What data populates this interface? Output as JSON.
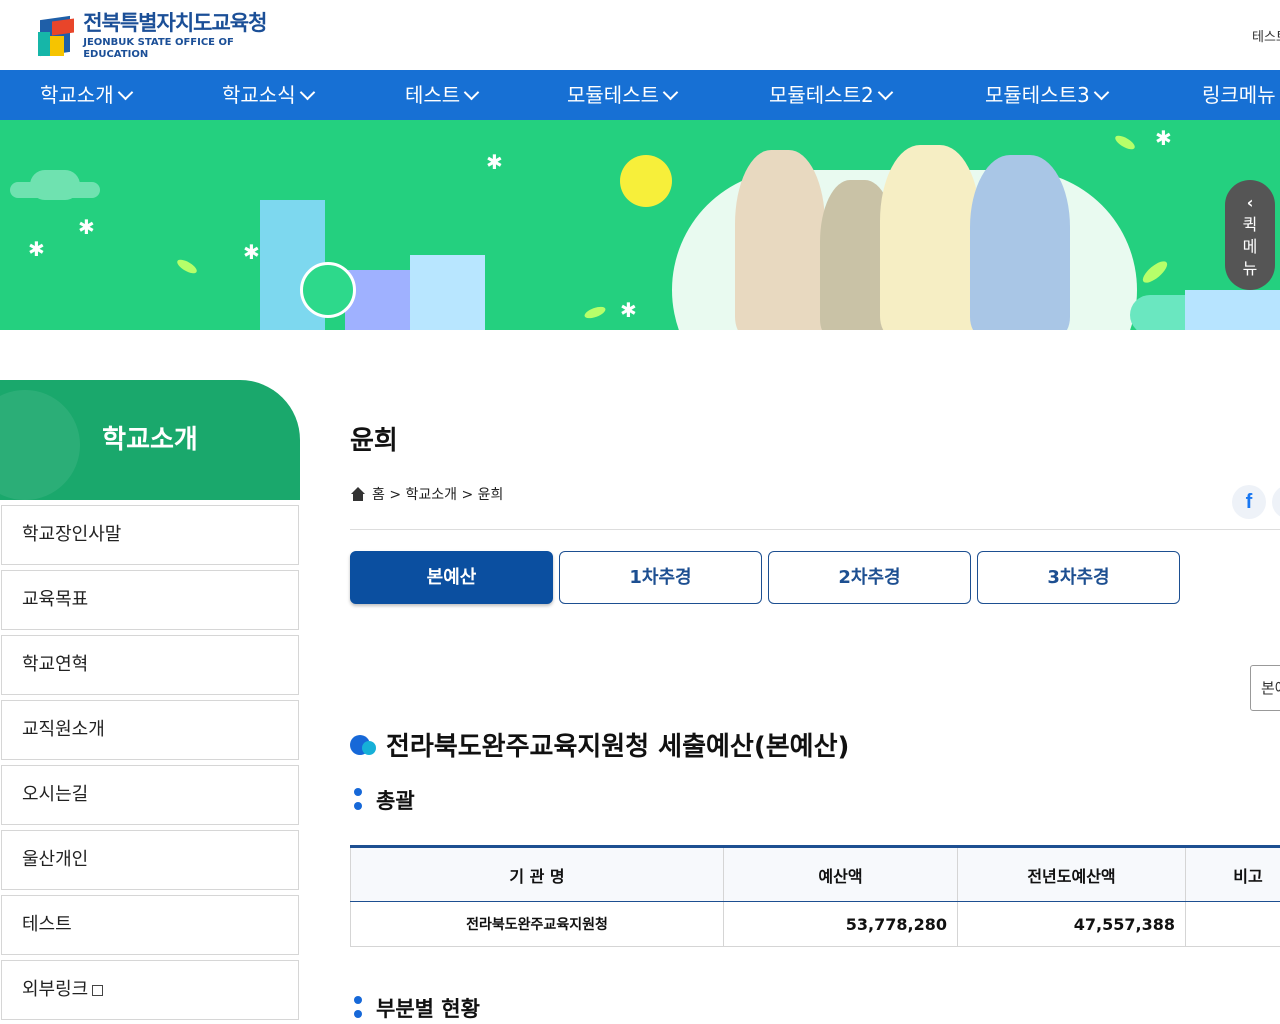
{
  "header": {
    "logo_kr": "전북특별자치도교육청",
    "logo_en": "JEONBUK STATE OFFICE OF EDUCATION",
    "right_link": "테스트"
  },
  "gnb": {
    "items": [
      "학교소개",
      "학교소식",
      "테스트",
      "모듈테스트",
      "모듈테스트2",
      "모듈테스트3",
      "링크메뉴"
    ]
  },
  "banner": {
    "quick_menu": [
      "퀵",
      "메",
      "뉴"
    ]
  },
  "sidebar": {
    "title": "학교소개",
    "items": [
      "학교장인사말",
      "교육목표",
      "학교연혁",
      "교직원소개",
      "오시는길",
      "울산개인",
      "테스트",
      "외부링크"
    ]
  },
  "content": {
    "title": "윤희",
    "breadcrumb": "홈 > 학교소개 > 윤희",
    "facebook": "f",
    "tabs": [
      "본예산",
      "1차추경",
      "2차추경",
      "3차추경"
    ],
    "select_value": "본예산",
    "heading": "전라북도완주교육지원청 세출예산(본예산)",
    "section1": "총괄",
    "section2": "부분별 현황",
    "table": {
      "headers": [
        "기 관 명",
        "예산액",
        "전년도예산액",
        "비고"
      ],
      "rows": [
        [
          "전라북도완주교육지원청",
          "53,778,280",
          "47,557,388",
          ""
        ]
      ]
    }
  },
  "colors": {
    "nav": "#1770d4",
    "banner": "#24d07f",
    "sidebar_title": "#1aa86c",
    "tab_active": "#0b4fa0"
  }
}
